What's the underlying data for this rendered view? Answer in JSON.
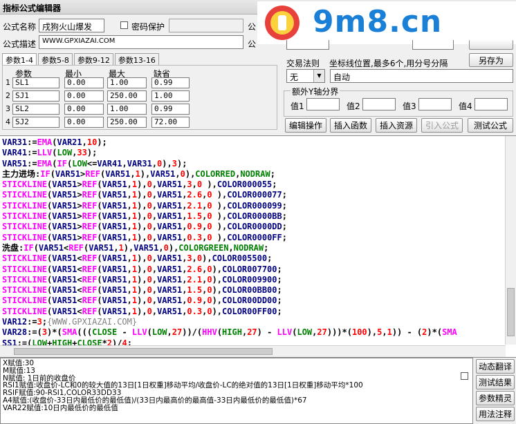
{
  "window": {
    "title": "指标公式编辑器"
  },
  "form": {
    "name_label": "公式名称",
    "name_value": "戌狗火山爆发",
    "password_label": "密码保护",
    "desc_label": "公式描述",
    "desc_value": "WWW.GPXIAZAI.COM",
    "extra_label_1": "公",
    "extra_label_2": "公"
  },
  "param_tabs": [
    "参数1-4",
    "参数5-8",
    "参数9-12",
    "参数13-16"
  ],
  "param_headers": [
    "参数",
    "最小",
    "最大",
    "缺省"
  ],
  "params": [
    {
      "idx": "1",
      "name": "SL1",
      "min": "0.00",
      "max": "1.00",
      "def": "0.99"
    },
    {
      "idx": "2",
      "name": "SJ1",
      "min": "0.00",
      "max": "250.00",
      "def": "1.00"
    },
    {
      "idx": "3",
      "name": "SL2",
      "min": "0.00",
      "max": "1.00",
      "def": "0.99"
    },
    {
      "idx": "4",
      "name": "SJ2",
      "min": "0.00",
      "max": "250.00",
      "def": "72.00"
    }
  ],
  "right_panel": {
    "save_as": "另存为",
    "trade_rule_label": "交易法则",
    "trade_rule_value": "无",
    "coord_label": "坐标线位置,最多6个,用分号分隔",
    "coord_value": "自动",
    "yaxis_label": "额外Y轴分界",
    "y_labels": [
      "值1",
      "值2",
      "值3",
      "值4"
    ]
  },
  "toolbar": {
    "edit": "编辑操作",
    "insert_func": "插入函数",
    "insert_res": "插入资源",
    "import": "引入公式",
    "test": "测试公式"
  },
  "code_lines": [
    "VAR31:=EMA(VAR21,10);",
    "VAR41:=LLV(LOW,33);",
    "VAR51:=EMA(IF(LOW<=VAR41,VAR31,0),3);",
    "主力进场:IF(VAR51>REF(VAR51,1),VAR51,0),COLORRED,NODRAW;",
    "STICKLINE(VAR51>REF(VAR51,1),0,VAR51,3,0 ),COLOR000055;",
    "STICKLINE(VAR51>REF(VAR51,1),0,VAR51,2.6,0 ),COLOR000077;",
    "STICKLINE(VAR51>REF(VAR51,1),0,VAR51,2.1,0 ),COLOR000099;",
    "STICKLINE(VAR51>REF(VAR51,1),0,VAR51,1.5,0 ),COLOR0000BB;",
    "STICKLINE(VAR51>REF(VAR51,1),0,VAR51,0.9,0 ),COLOR0000DD;",
    "STICKLINE(VAR51>REF(VAR51,1),0,VAR51,0.3,0 ),COLOR0000FF;",
    "洗盘:IF(VAR51<REF(VAR51,1),VAR51,0),COLORGREEN,NODRAW;",
    "STICKLINE(VAR51<REF(VAR51,1),0,VAR51,3,0),COLOR005500;",
    "STICKLINE(VAR51<REF(VAR51,1),0,VAR51,2.6,0),COLOR007700;",
    "STICKLINE(VAR51<REF(VAR51,1),0,VAR51,2.1,0),COLOR009900;",
    "STICKLINE(VAR51<REF(VAR51,1),0,VAR51,1.5,0),COLOR00BB00;",
    "STICKLINE(VAR51<REF(VAR51,1),0,VAR51,0.9,0),COLOR00DD00;",
    "STICKLINE(VAR51<REF(VAR51,1),0,VAR51,0.3,0),COLOR00FF00;",
    "VAR12:=3;{WWW.GPXIAZAI.COM}",
    "VAR28:=(3)*(SMA(((CLOSE - LLV(LOW,27))/(HHV(HIGH,27) - LLV(LOW,27)))*(100),5,1)) - (2)*(SMA",
    "SS1:=(LOW+HIGH+CLOSE*2)/4;"
  ],
  "help_lines": [
    "X赋值:30",
    "M赋值:13",
    "N赋值: 1日前的收盘价",
    "RSI1赋值:收盘价-LC和0的较大值的13日[1日权重]移动平均/收盘价-LC的绝对值的13日[1日权重]移动平均*100",
    "RSIF赋值:90-RSI1,COLOR33DD33",
    "A4赋值:(收盘价-33日内最低价的最低值)/(33日内最高价的最高值-33日内最低价的最低值)*67",
    "VAR22赋值:10日内最低价的最低值"
  ],
  "side_buttons": [
    "动态翻译",
    "测试结果",
    "参数精灵",
    "用法注释"
  ],
  "watermark": {
    "text": "9m8.cn"
  },
  "colors": {
    "keyword": "#008000",
    "func": "#ff00ff",
    "number": "#ff0000",
    "ident": "#000080",
    "comment": "#808080"
  }
}
